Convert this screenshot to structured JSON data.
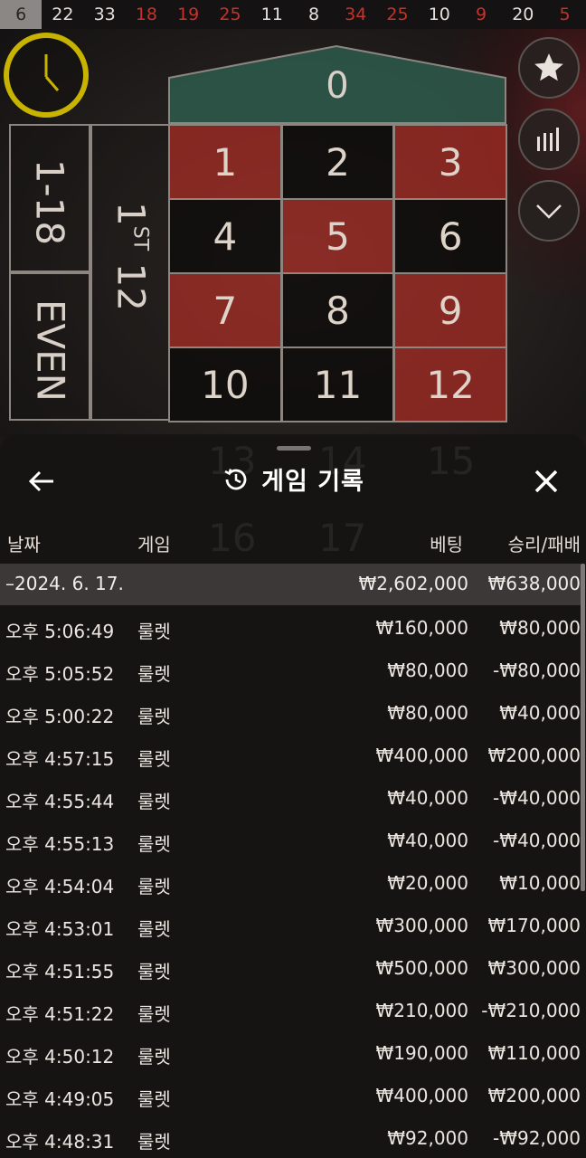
{
  "results": [
    {
      "n": "6",
      "color": "first"
    },
    {
      "n": "22",
      "color": "black"
    },
    {
      "n": "33",
      "color": "black"
    },
    {
      "n": "18",
      "color": "red"
    },
    {
      "n": "19",
      "color": "red"
    },
    {
      "n": "25",
      "color": "red"
    },
    {
      "n": "11",
      "color": "black"
    },
    {
      "n": "8",
      "color": "black"
    },
    {
      "n": "34",
      "color": "red"
    },
    {
      "n": "25",
      "color": "red"
    },
    {
      "n": "10",
      "color": "black"
    },
    {
      "n": "9",
      "color": "red"
    },
    {
      "n": "20",
      "color": "black"
    },
    {
      "n": "5",
      "color": "red"
    }
  ],
  "board": {
    "zero": "0",
    "numbers": [
      {
        "n": "1",
        "color": "red"
      },
      {
        "n": "2",
        "color": "black"
      },
      {
        "n": "3",
        "color": "red"
      },
      {
        "n": "4",
        "color": "black"
      },
      {
        "n": "5",
        "color": "red"
      },
      {
        "n": "6",
        "color": "black"
      },
      {
        "n": "7",
        "color": "red"
      },
      {
        "n": "8",
        "color": "black"
      },
      {
        "n": "9",
        "color": "red"
      },
      {
        "n": "10",
        "color": "black"
      },
      {
        "n": "11",
        "color": "black"
      },
      {
        "n": "12",
        "color": "red"
      }
    ],
    "low_label": "1-18",
    "even_label": "EVEN",
    "dozen_first": "1",
    "dozen_suffix": "ST",
    "dozen_rest": "12"
  },
  "colors": {
    "red": "#a02a24",
    "timer": "#c8b400",
    "zero": "#2e5a4c"
  },
  "icons": [
    "clock-icon",
    "star-icon",
    "stats-bars-icon",
    "chevron-down-icon",
    "back-arrow-icon",
    "history-icon",
    "close-icon"
  ],
  "sheet": {
    "title": "게임 기록",
    "headers": {
      "date": "날짜",
      "game": "게임",
      "bet": "베팅",
      "winloss": "승리/패배"
    },
    "day": {
      "label": "–2024. 6. 17.",
      "bet": "₩2,602,000",
      "winloss": "₩638,000"
    },
    "rows": [
      {
        "time": "오후 5:06:49",
        "game": "룰렛",
        "bet": "₩160,000",
        "winloss": "₩80,000"
      },
      {
        "time": "오후 5:05:52",
        "game": "룰렛",
        "bet": "₩80,000",
        "winloss": "-₩80,000"
      },
      {
        "time": "오후 5:00:22",
        "game": "룰렛",
        "bet": "₩80,000",
        "winloss": "₩40,000"
      },
      {
        "time": "오후 4:57:15",
        "game": "룰렛",
        "bet": "₩400,000",
        "winloss": "₩200,000"
      },
      {
        "time": "오후 4:55:44",
        "game": "룰렛",
        "bet": "₩40,000",
        "winloss": "-₩40,000"
      },
      {
        "time": "오후 4:55:13",
        "game": "룰렛",
        "bet": "₩40,000",
        "winloss": "-₩40,000"
      },
      {
        "time": "오후 4:54:04",
        "game": "룰렛",
        "bet": "₩20,000",
        "winloss": "₩10,000"
      },
      {
        "time": "오후 4:53:01",
        "game": "룰렛",
        "bet": "₩300,000",
        "winloss": "₩170,000"
      },
      {
        "time": "오후 4:51:55",
        "game": "룰렛",
        "bet": "₩500,000",
        "winloss": "₩300,000"
      },
      {
        "time": "오후 4:51:22",
        "game": "룰렛",
        "bet": "₩210,000",
        "winloss": "-₩210,000"
      },
      {
        "time": "오후 4:50:12",
        "game": "룰렛",
        "bet": "₩190,000",
        "winloss": "₩110,000"
      },
      {
        "time": "오후 4:49:05",
        "game": "룰렛",
        "bet": "₩400,000",
        "winloss": "₩200,000"
      },
      {
        "time": "오후 4:48:31",
        "game": "룰렛",
        "bet": "₩92,000",
        "winloss": "-₩92,000"
      }
    ]
  }
}
